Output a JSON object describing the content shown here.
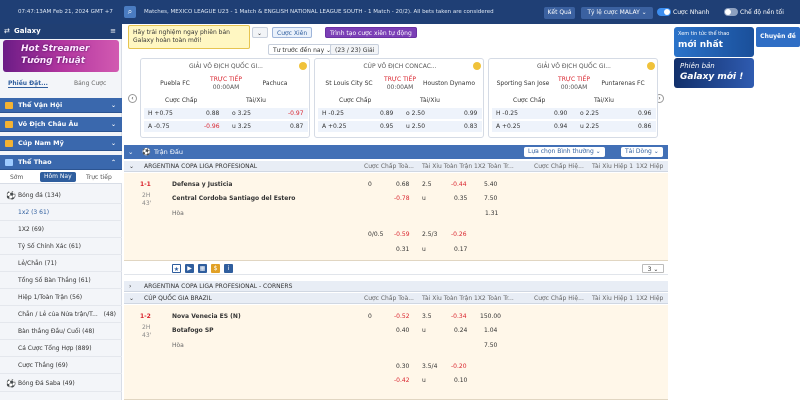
{
  "topbar": {
    "time": "07:47:13AM Feb 21, 2024 GMT +7",
    "ticker": "Matches, MEXICO LEAGUE U23 - 1 Match & ENGLISH NATIONAL LEAGUE SOUTH - 1 Match - 20/2). All bets taken are considered",
    "ket_qua": "Kết Quả",
    "ty_le": "Tỷ lệ cược MALAY ⌄",
    "cuoc_nhanh": "Cược Nhanh",
    "che_do": "Chế độ nền tối"
  },
  "sidebar": {
    "brand": "Galaxy",
    "banner_text": "Hot Streamer\nTướng Thuật",
    "tab_active": "Phiếu Đặt...",
    "tab_other": "Bảng Cược",
    "sections": [
      {
        "label": "Thể Vận Hội"
      },
      {
        "label": "Vô Địch Châu Âu"
      },
      {
        "label": "Cúp Nam Mỹ"
      },
      {
        "label": "Thể Thao"
      }
    ],
    "subtabs": [
      "Sớm",
      "Hôm Nay",
      "Trực tiếp"
    ],
    "items": [
      {
        "label": "Bóng đá",
        "count": "(134)"
      },
      {
        "label": "1x2 (3 61)",
        "count": ""
      },
      {
        "label": "1X2",
        "count": "(69)"
      },
      {
        "label": "Tỷ Số Chính Xác",
        "count": "(61)"
      },
      {
        "label": "Lẻ/Chẵn",
        "count": "(71)"
      },
      {
        "label": "Tổng Số Bàn Thắng",
        "count": "(61)"
      },
      {
        "label": "Hiệp 1/Toàn Trận",
        "count": "(56)"
      },
      {
        "label": "Chẵn / Lẻ của Nửa trận/T...",
        "count": "(48)"
      },
      {
        "label": "Bàn thắng Đầu/ Cuối",
        "count": "(48)"
      },
      {
        "label": "Cá Cược Tổng Hợp",
        "count": "(889)"
      },
      {
        "label": "Cược Thắng",
        "count": "(69)"
      },
      {
        "label": "Bóng Đá Saba",
        "count": "(49)"
      }
    ]
  },
  "tooltip": "Hãy trải nghiệm ngay phiên bản Galaxy hoàn toàn mới!",
  "filters": {
    "cuoc_xien": "Cược Xiên",
    "trinh_tao": "Trình tạo cược xiên tự động",
    "sort": "Tư trước đến nay ⌄",
    "count": "(23 / 23) Giải"
  },
  "cards": [
    {
      "league": "GIẢI VÔ ĐỊCH QUỐC GI...",
      "team1": "Puebla FC",
      "team2": "Pachuca",
      "live": "TRỰC TIẾP",
      "clock": "00:00AM",
      "rows": [
        [
          "H +0.75",
          "0.88",
          "o 3.25",
          "-0.97"
        ],
        [
          "A -0.75",
          "-0.96",
          "u 3.25",
          "0.87"
        ]
      ]
    },
    {
      "league": "CÚP VÔ ĐỊCH CONCAC...",
      "team1": "St Louis City SC",
      "team2": "Houston Dynamo",
      "live": "TRỰC TIẾP",
      "clock": "00:00AM",
      "rows": [
        [
          "H -0.25",
          "0.89",
          "o 2.50",
          "0.99"
        ],
        [
          "A +0.25",
          "0.95",
          "u 2.50",
          "0.83"
        ]
      ]
    },
    {
      "league": "GIẢI VÔ ĐỊCH QUỐC GI...",
      "team1": "Sporting San Jose",
      "team2": "Puntarenas FC",
      "live": "TRỰC TIẾP",
      "clock": "00:00AM",
      "rows": [
        [
          "H -0.25",
          "0.90",
          "o 2.25",
          "0.96"
        ],
        [
          "A +0.25",
          "0.94",
          "u 2.25",
          "0.86"
        ]
      ]
    }
  ],
  "card_headers": {
    "chap": "Cược Chấp",
    "taixiu": "Tài/Xỉu"
  },
  "section": {
    "title": "Trận Đấu",
    "sort_btn": "Lựa chọn Bình thường ⌄",
    "view_btn": "Tải Dòng ⌄"
  },
  "col_headers": [
    "Cược Chấp Toà...",
    "Tài Xỉu Toàn Trận",
    "1X2 Toàn Tr...",
    "Cược Chấp Hiệ...",
    "Tài Xỉu Hiệp 1",
    "1X2 Hiệp 1"
  ],
  "leagues": [
    {
      "name": "ARGENTINA COPA LIGA PROFESIONAL"
    },
    {
      "name": "ARGENTINA COPA LIGA PROFESIONAL - CORNERS"
    },
    {
      "name": "CÚP QUỐC GIA BRAZIL"
    }
  ],
  "match1": {
    "score": "1-1",
    "period": "2H",
    "minute": "43'",
    "home": "Defensa y Justicia",
    "away": "Central Cordoba Santiago del Estero",
    "draw": "Hòa",
    "rows": [
      [
        "0",
        "0.68",
        "2.5",
        "-0.44",
        "5.40"
      ],
      [
        "",
        "-0.78",
        "u",
        "0.35",
        "7.50"
      ],
      [
        "",
        "",
        "",
        "",
        "1.31"
      ]
    ],
    "extra": [
      [
        "0/0.5",
        "-0.59",
        "2.5/3",
        "-0.26"
      ],
      [
        "",
        "0.31",
        "u",
        "0.17"
      ]
    ],
    "more": "3 ⌄"
  },
  "match2": {
    "score": "1-2",
    "period": "2H",
    "minute": "43'",
    "home": "Nova Venecia ES (N)",
    "away": "Botafogo SP",
    "draw": "Hòa",
    "rows": [
      [
        "0",
        "-0.52",
        "3.5",
        "-0.34",
        "150.00"
      ],
      [
        "",
        "0.40",
        "u",
        "0.24",
        "1.04"
      ],
      [
        "",
        "",
        "",
        "",
        "7.50"
      ]
    ],
    "extra": [
      [
        "",
        "0.30",
        "3.5/4",
        "-0.20"
      ],
      [
        "",
        "-0.42",
        "u",
        "0.10"
      ]
    ]
  },
  "right": {
    "ad1_line1": "Xem tin tức thể thao",
    "ad1_line2": "mới nhất",
    "ad_tag": "Chuyên đề",
    "ad2_line1": "Phiên bản",
    "ad2_line2": "Galaxy mới !"
  }
}
